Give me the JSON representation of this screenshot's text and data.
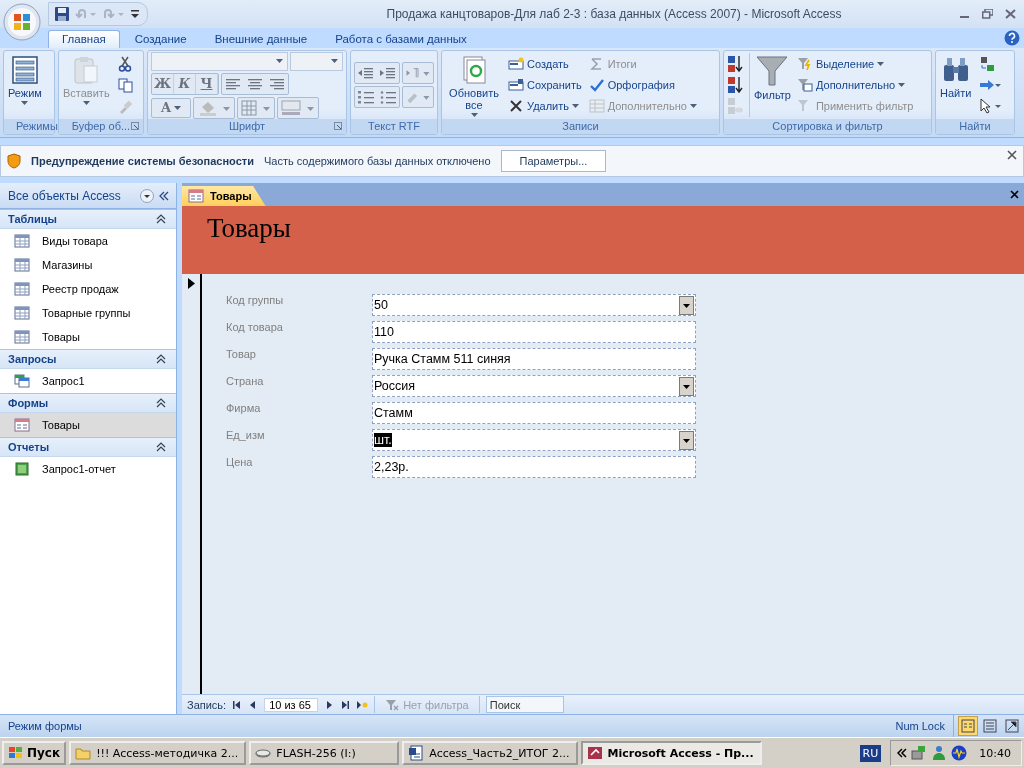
{
  "window": {
    "title": "Продажа канцтоваров-Для лаб 2-3 : база данных (Access 2007) - Microsoft Access"
  },
  "ribbon_tabs": [
    {
      "label": "Главная",
      "selected": true
    },
    {
      "label": "Создание",
      "selected": false
    },
    {
      "label": "Внешние данные",
      "selected": false
    },
    {
      "label": "Работа с базами данных",
      "selected": false
    }
  ],
  "ribbon_groups": [
    {
      "label": "Режимы",
      "items": [
        {
          "label": "Режим",
          "disabled": false
        }
      ]
    },
    {
      "label": "Буфер об...",
      "items": [
        {
          "label": "Вставить",
          "disabled": true
        }
      ]
    },
    {
      "label": "Шрифт",
      "items": [
        {
          "label": "Ж",
          "disabled": true
        },
        {
          "label": "К",
          "disabled": true
        },
        {
          "label": "Ч",
          "disabled": true
        },
        {
          "label": "A",
          "disabled": true
        }
      ]
    },
    {
      "label": "Текст RTF"
    },
    {
      "label": "Записи",
      "items": [
        {
          "label": "Обновить все",
          "disabled": false
        },
        {
          "label": "Создать",
          "disabled": false
        },
        {
          "label": "Сохранить",
          "disabled": false
        },
        {
          "label": "Удалить",
          "disabled": false
        },
        {
          "label": "Итоги",
          "disabled": true
        },
        {
          "label": "Орфография",
          "disabled": false
        },
        {
          "label": "Дополнительно",
          "disabled": true
        }
      ]
    },
    {
      "label": "Сортировка и фильтр",
      "items": [
        {
          "label": "Фильтр",
          "disabled": false
        },
        {
          "label": "Выделение",
          "disabled": false
        },
        {
          "label": "Дополнительно",
          "disabled": false
        },
        {
          "label": "Применить фильтр",
          "disabled": true
        }
      ]
    },
    {
      "label": "Найти",
      "items": [
        {
          "label": "Найти",
          "disabled": false
        }
      ]
    }
  ],
  "security_bar": {
    "title": "Предупреждение системы безопасности",
    "message": "Часть содержимого базы данных отключено",
    "button": "Параметры..."
  },
  "navigation_pane": {
    "title": "Все объекты Access",
    "sections": [
      {
        "title": "Таблицы",
        "kind": "table",
        "expanded": true,
        "items": [
          {
            "label": "Виды товара",
            "selected": false
          },
          {
            "label": "Магазины",
            "selected": false
          },
          {
            "label": "Реестр продаж",
            "selected": false
          },
          {
            "label": "Товарные группы",
            "selected": false
          },
          {
            "label": "Товары",
            "selected": false
          }
        ]
      },
      {
        "title": "Запросы",
        "kind": "query",
        "expanded": true,
        "items": [
          {
            "label": "Запрос1",
            "selected": false
          }
        ]
      },
      {
        "title": "Формы",
        "kind": "form",
        "expanded": true,
        "items": [
          {
            "label": "Товары",
            "selected": true
          }
        ]
      },
      {
        "title": "Отчеты",
        "kind": "report",
        "expanded": true,
        "items": [
          {
            "label": "Запрос1-отчет",
            "selected": false
          }
        ]
      }
    ]
  },
  "document_tabs": [
    {
      "label": "Товары",
      "selected": true
    }
  ],
  "form": {
    "header": "Товары",
    "fields": [
      {
        "label": "Код группы",
        "value": "50",
        "kind": "combo",
        "highlighted": false
      },
      {
        "label": "Код товара",
        "value": "110",
        "kind": "text",
        "highlighted": false
      },
      {
        "label": "Товар",
        "value": "Ручка Стамм 511 синяя",
        "kind": "text",
        "highlighted": false
      },
      {
        "label": "Страна",
        "value": "Россия",
        "kind": "combo",
        "highlighted": false
      },
      {
        "label": "Фирма",
        "value": "Стамм",
        "kind": "text",
        "highlighted": false
      },
      {
        "label": "Ед_изм",
        "value": "шт.",
        "kind": "combo",
        "highlighted": true
      },
      {
        "label": "Цена",
        "value": "2,23р.",
        "kind": "text",
        "highlighted": false
      }
    ]
  },
  "record_navigation": {
    "label": "Запись:",
    "position": "10 из 65",
    "filter": {
      "label": "Нет фильтра",
      "disabled": true
    },
    "search": {
      "placeholder": "Поиск"
    }
  },
  "status_bar": {
    "mode": "Режим формы",
    "indicator": "Num Lock",
    "views": [
      {
        "selected": true
      },
      {
        "selected": false
      },
      {
        "selected": false
      }
    ]
  },
  "taskbar": {
    "start": "Пуск",
    "tasks": [
      {
        "label": "!!! Access-методичка 2...",
        "kind": "folder",
        "selected": false
      },
      {
        "label": "FLASH-256 (I:)",
        "kind": "drive",
        "selected": false
      },
      {
        "label": "Access_Часть2_ИТОГ 2...",
        "kind": "word",
        "selected": false
      },
      {
        "label": "Microsoft Access - Пр...",
        "kind": "access",
        "selected": true
      }
    ],
    "language": "RU",
    "clock": "10:40"
  }
}
